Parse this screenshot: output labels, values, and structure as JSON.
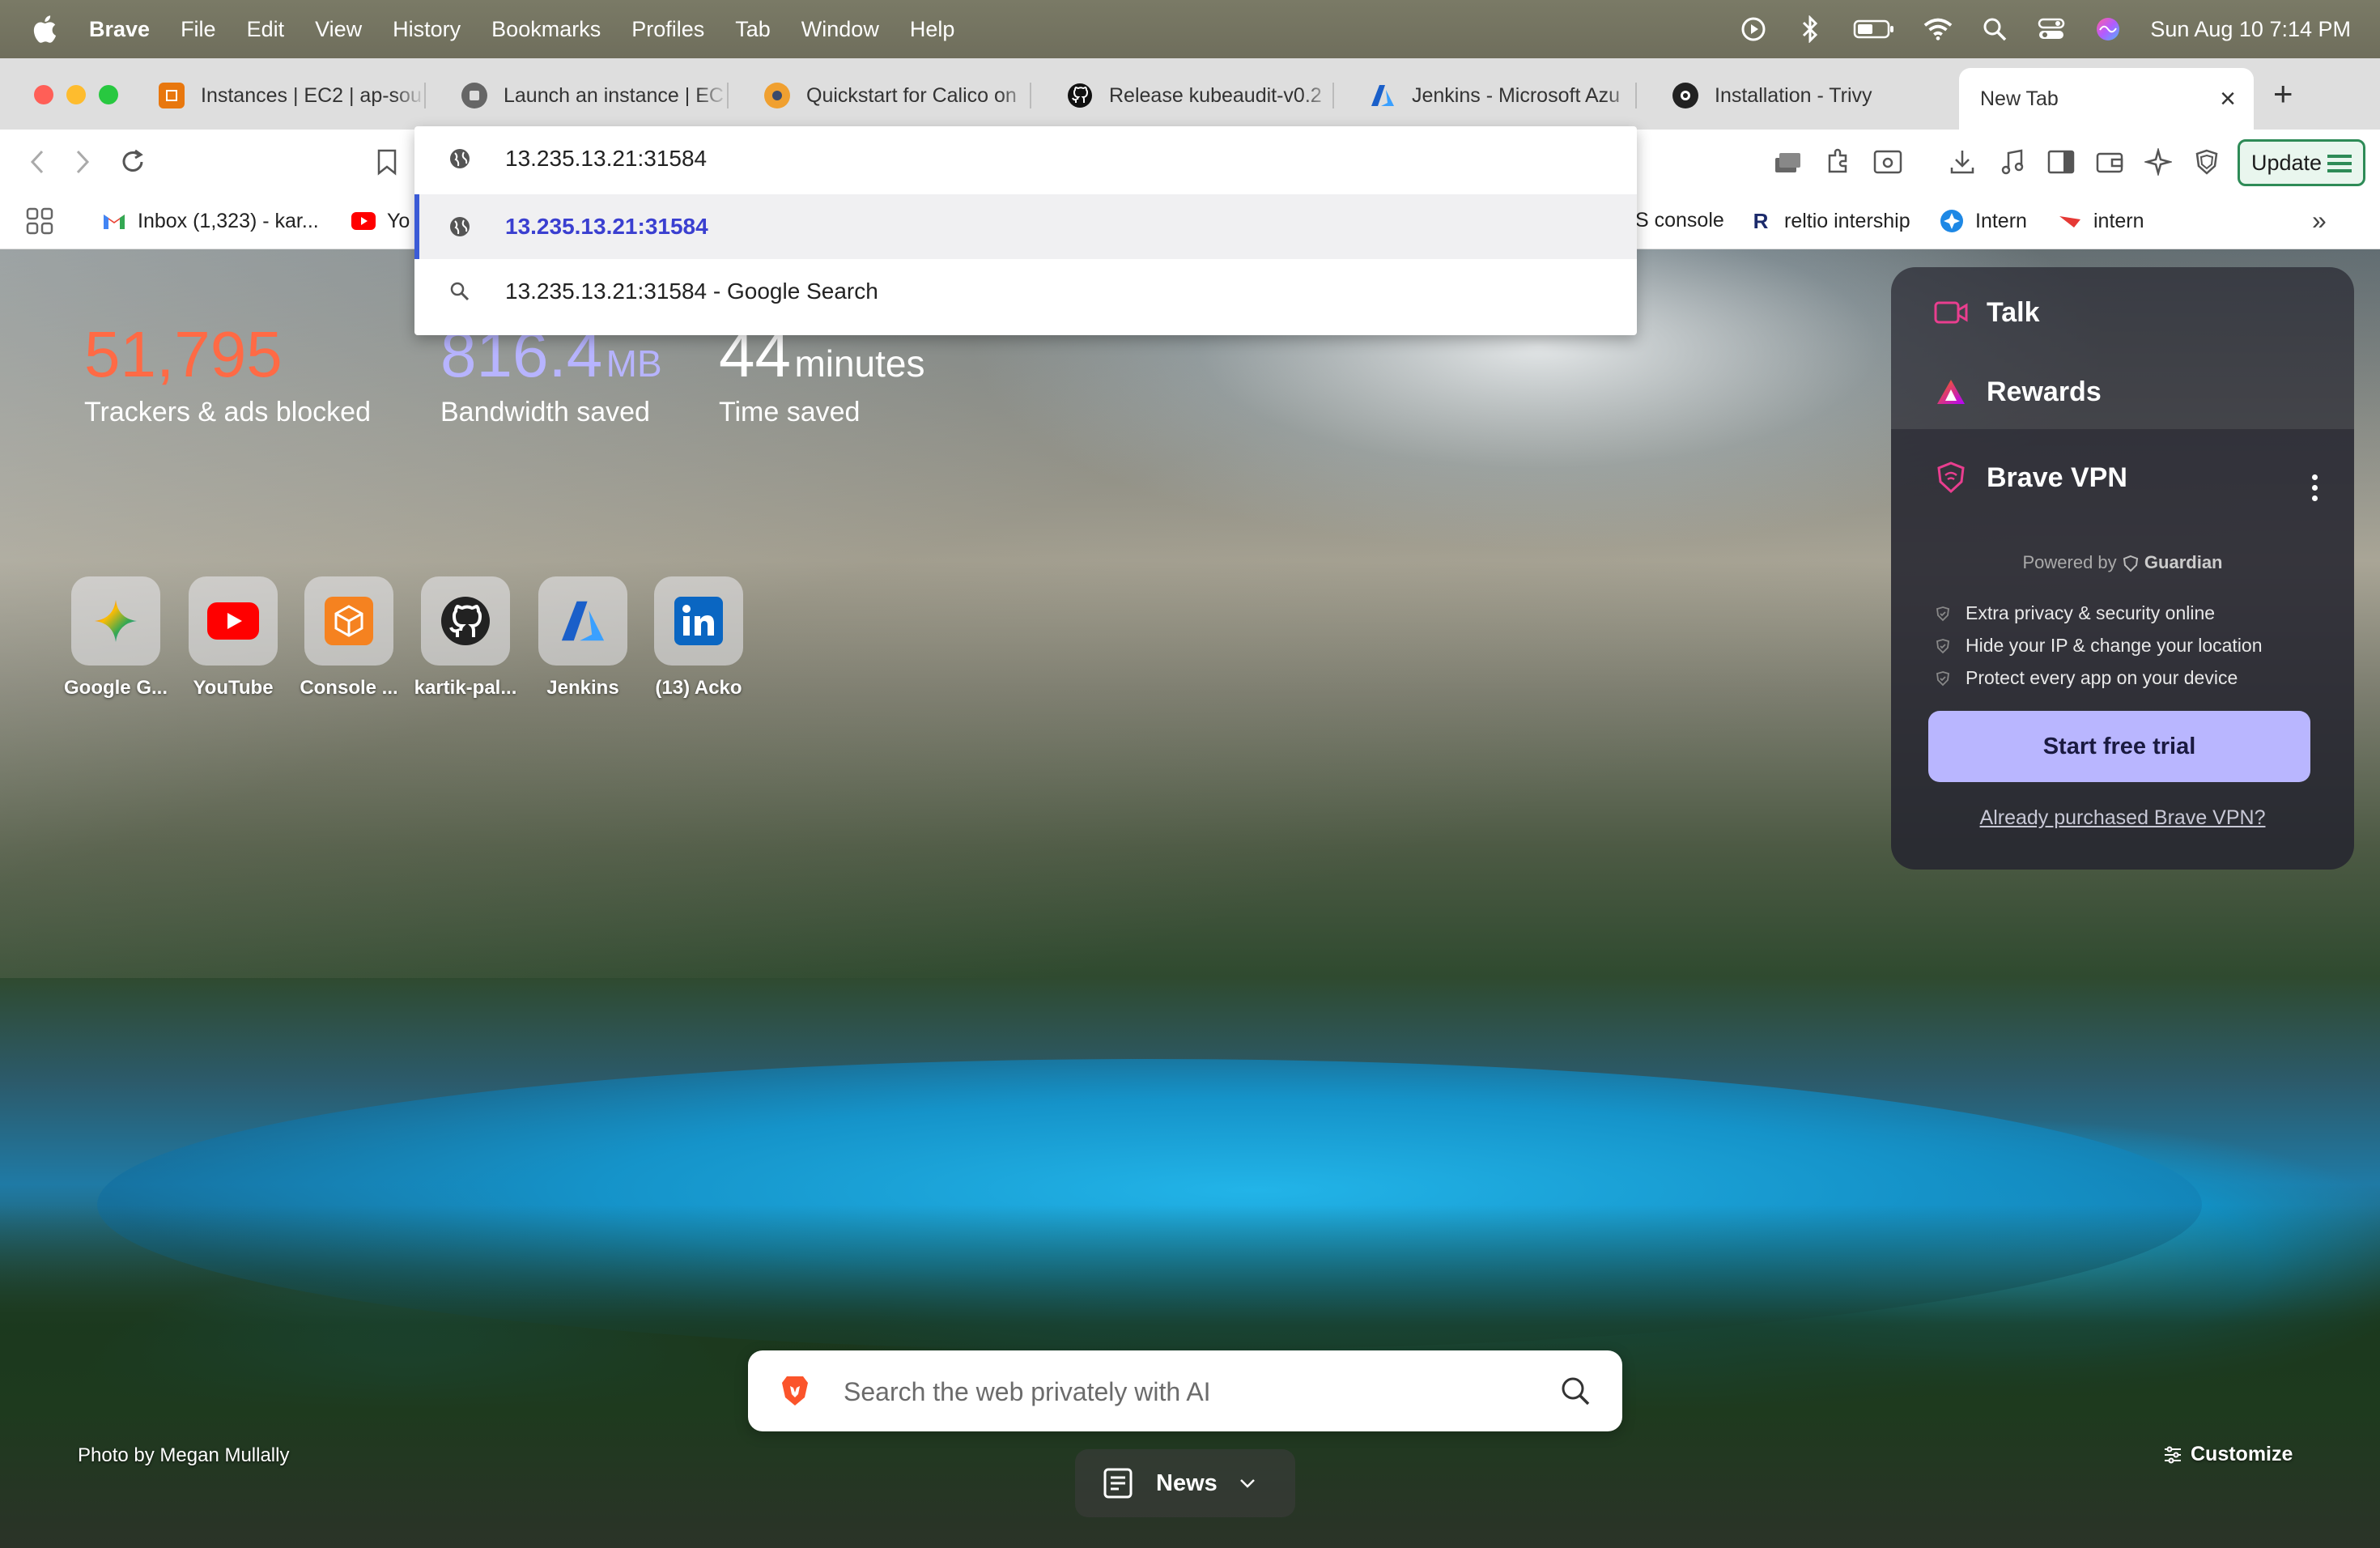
{
  "menubar": {
    "app": "Brave",
    "items": [
      "File",
      "Edit",
      "View",
      "History",
      "Bookmarks",
      "Profiles",
      "Tab",
      "Window",
      "Help"
    ],
    "datetime": "Sun Aug 10  7:14 PM"
  },
  "tabs": [
    {
      "title": "Instances | EC2 | ap-sou",
      "icon": "aws-ec2-icon",
      "color": "#e8770e"
    },
    {
      "title": "Launch an instance | EC",
      "icon": "aws-launch-icon",
      "color": "#555555"
    },
    {
      "title": "Quickstart for Calico on",
      "icon": "calico-icon",
      "color": "#f0a030"
    },
    {
      "title": "Release kubeaudit-v0.2",
      "icon": "github-icon",
      "color": "#111111"
    },
    {
      "title": "Jenkins - Microsoft Azu",
      "icon": "azure-icon",
      "color": "#1f6fd8"
    },
    {
      "title": "Installation - Trivy",
      "icon": "trivy-icon",
      "color": "#222222"
    }
  ],
  "active_tab": {
    "title": "New Tab",
    "close": "×"
  },
  "new_tab_symbol": "+",
  "toolbar": {
    "update_label": "Update"
  },
  "omnibox": {
    "input": "13.235.13.21:31584",
    "suggestions": [
      {
        "text": "13.235.13.21:31584",
        "icon": "globe-icon"
      },
      {
        "text": "13.235.13.21:31584 - Google Search",
        "icon": "search-icon"
      }
    ]
  },
  "bookmarks": {
    "left": [
      {
        "label": "Inbox (1,323) - kar...",
        "icon": "gmail-icon"
      },
      {
        "label": "Yo",
        "icon": "youtube-icon"
      }
    ],
    "right": [
      {
        "label": "S console",
        "icon": ""
      },
      {
        "label": "reltio intership",
        "icon": "reltio-icon"
      },
      {
        "label": "Intern",
        "icon": "intern-icon"
      },
      {
        "label": "intern",
        "icon": "intern-red-icon"
      }
    ],
    "more": "»"
  },
  "stats": {
    "trackers": {
      "value": "51,795",
      "label": "Trackers & ads blocked",
      "color": "#ff6a45"
    },
    "bandwidth": {
      "value": "816.4",
      "unit": "MB",
      "label": "Bandwidth saved",
      "color": "#b7b4ff"
    },
    "time": {
      "value": "44",
      "unit": "minutes",
      "label": "Time saved",
      "color": "#ffffff"
    }
  },
  "top_sites": [
    {
      "name": "Google G...",
      "icon": "gemini-icon"
    },
    {
      "name": "YouTube",
      "icon": "youtube-icon"
    },
    {
      "name": "Console ...",
      "icon": "aws-console-icon"
    },
    {
      "name": "kartik-pal...",
      "icon": "github-icon"
    },
    {
      "name": "Jenkins",
      "icon": "azure-icon"
    },
    {
      "name": "(13) Acko",
      "icon": "linkedin-icon"
    }
  ],
  "right_panel": {
    "talk": "Talk",
    "rewards": "Rewards",
    "vpn": {
      "title": "Brave VPN",
      "powered_by": "Powered by",
      "powered_brand": "Guardian",
      "features": [
        "Extra privacy & security online",
        "Hide your IP & change your location",
        "Protect every app on your device"
      ],
      "cta": "Start free trial",
      "already": "Already purchased Brave VPN?"
    }
  },
  "search": {
    "placeholder": "Search the web privately with AI"
  },
  "credit": "Photo by Megan Mullally",
  "news": "News",
  "customize": "Customize"
}
